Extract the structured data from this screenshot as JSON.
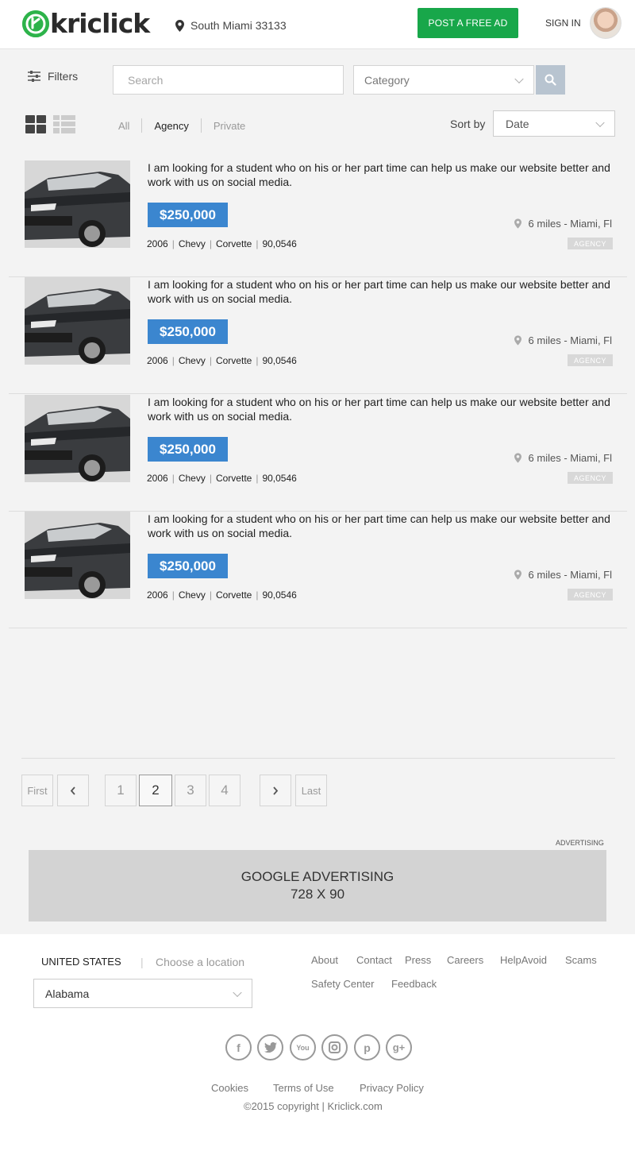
{
  "header": {
    "logo_text": "kriclick",
    "location": "South Miami 33133",
    "post_ad_label": "POST A FREE AD",
    "signin_label": "SIGN IN"
  },
  "filters": {
    "label": "Filters",
    "search_placeholder": "Search",
    "category_label": "Category"
  },
  "tabs": [
    "All",
    "Agency",
    "Private"
  ],
  "active_tab": "Agency",
  "sort": {
    "label": "Sort by",
    "value": "Date"
  },
  "listings": [
    {
      "description": "I am looking for a student who on his or her part time can help us make our website better and work with us on social media.",
      "price": "$250,000",
      "distance": "6 miles - Miami, Fl",
      "year": "2006",
      "make": "Chevy",
      "model": "Corvette",
      "mileage": "90,0546",
      "badge": "AGENCY"
    },
    {
      "description": "I am looking for a student who on his or her part time can help us make our website better and work with us on social media.",
      "price": "$250,000",
      "distance": "6 miles - Miami, Fl",
      "year": "2006",
      "make": "Chevy",
      "model": "Corvette",
      "mileage": "90,0546",
      "badge": "AGENCY"
    },
    {
      "description": "I am looking for a student who on his or her part time can help us make our website better and work with us on social media.",
      "price": "$250,000",
      "distance": "6 miles - Miami, Fl",
      "year": "2006",
      "make": "Chevy",
      "model": "Corvette",
      "mileage": "90,0546",
      "badge": "AGENCY"
    },
    {
      "description": "I am looking for a student who on his or her part time can help us make our website better and work with us on social media.",
      "price": "$250,000",
      "distance": "6 miles - Miami, Fl",
      "year": "2006",
      "make": "Chevy",
      "model": "Corvette",
      "mileage": "90,0546",
      "badge": "AGENCY"
    }
  ],
  "pagination": {
    "first": "First",
    "last": "Last",
    "pages": [
      "1",
      "2",
      "3",
      "4"
    ],
    "current": "2"
  },
  "ad": {
    "label": "ADVERTISING",
    "line1": "GOOGLE ADVERTISING",
    "line2": "728 X 90"
  },
  "footer": {
    "country": "UNITED STATES",
    "choose_location": "Choose a location",
    "state": "Alabama",
    "links": [
      "About",
      "Contact",
      "Press",
      "Careers",
      "HelpAvoid",
      "Scams",
      "Safety Center",
      "Feedback"
    ],
    "social": [
      "facebook-icon",
      "twitter-icon",
      "youtube-icon",
      "instagram-icon",
      "pinterest-icon",
      "google-plus-icon"
    ],
    "legal": [
      "Cookies",
      "Terms of Use",
      "Privacy Policy"
    ],
    "copyright": "©2015 copyright  |  Kriclick.com"
  },
  "colors": {
    "brand_green": "#18a74a",
    "price_blue": "#3b86cf",
    "search_button": "#b8c4d0"
  }
}
